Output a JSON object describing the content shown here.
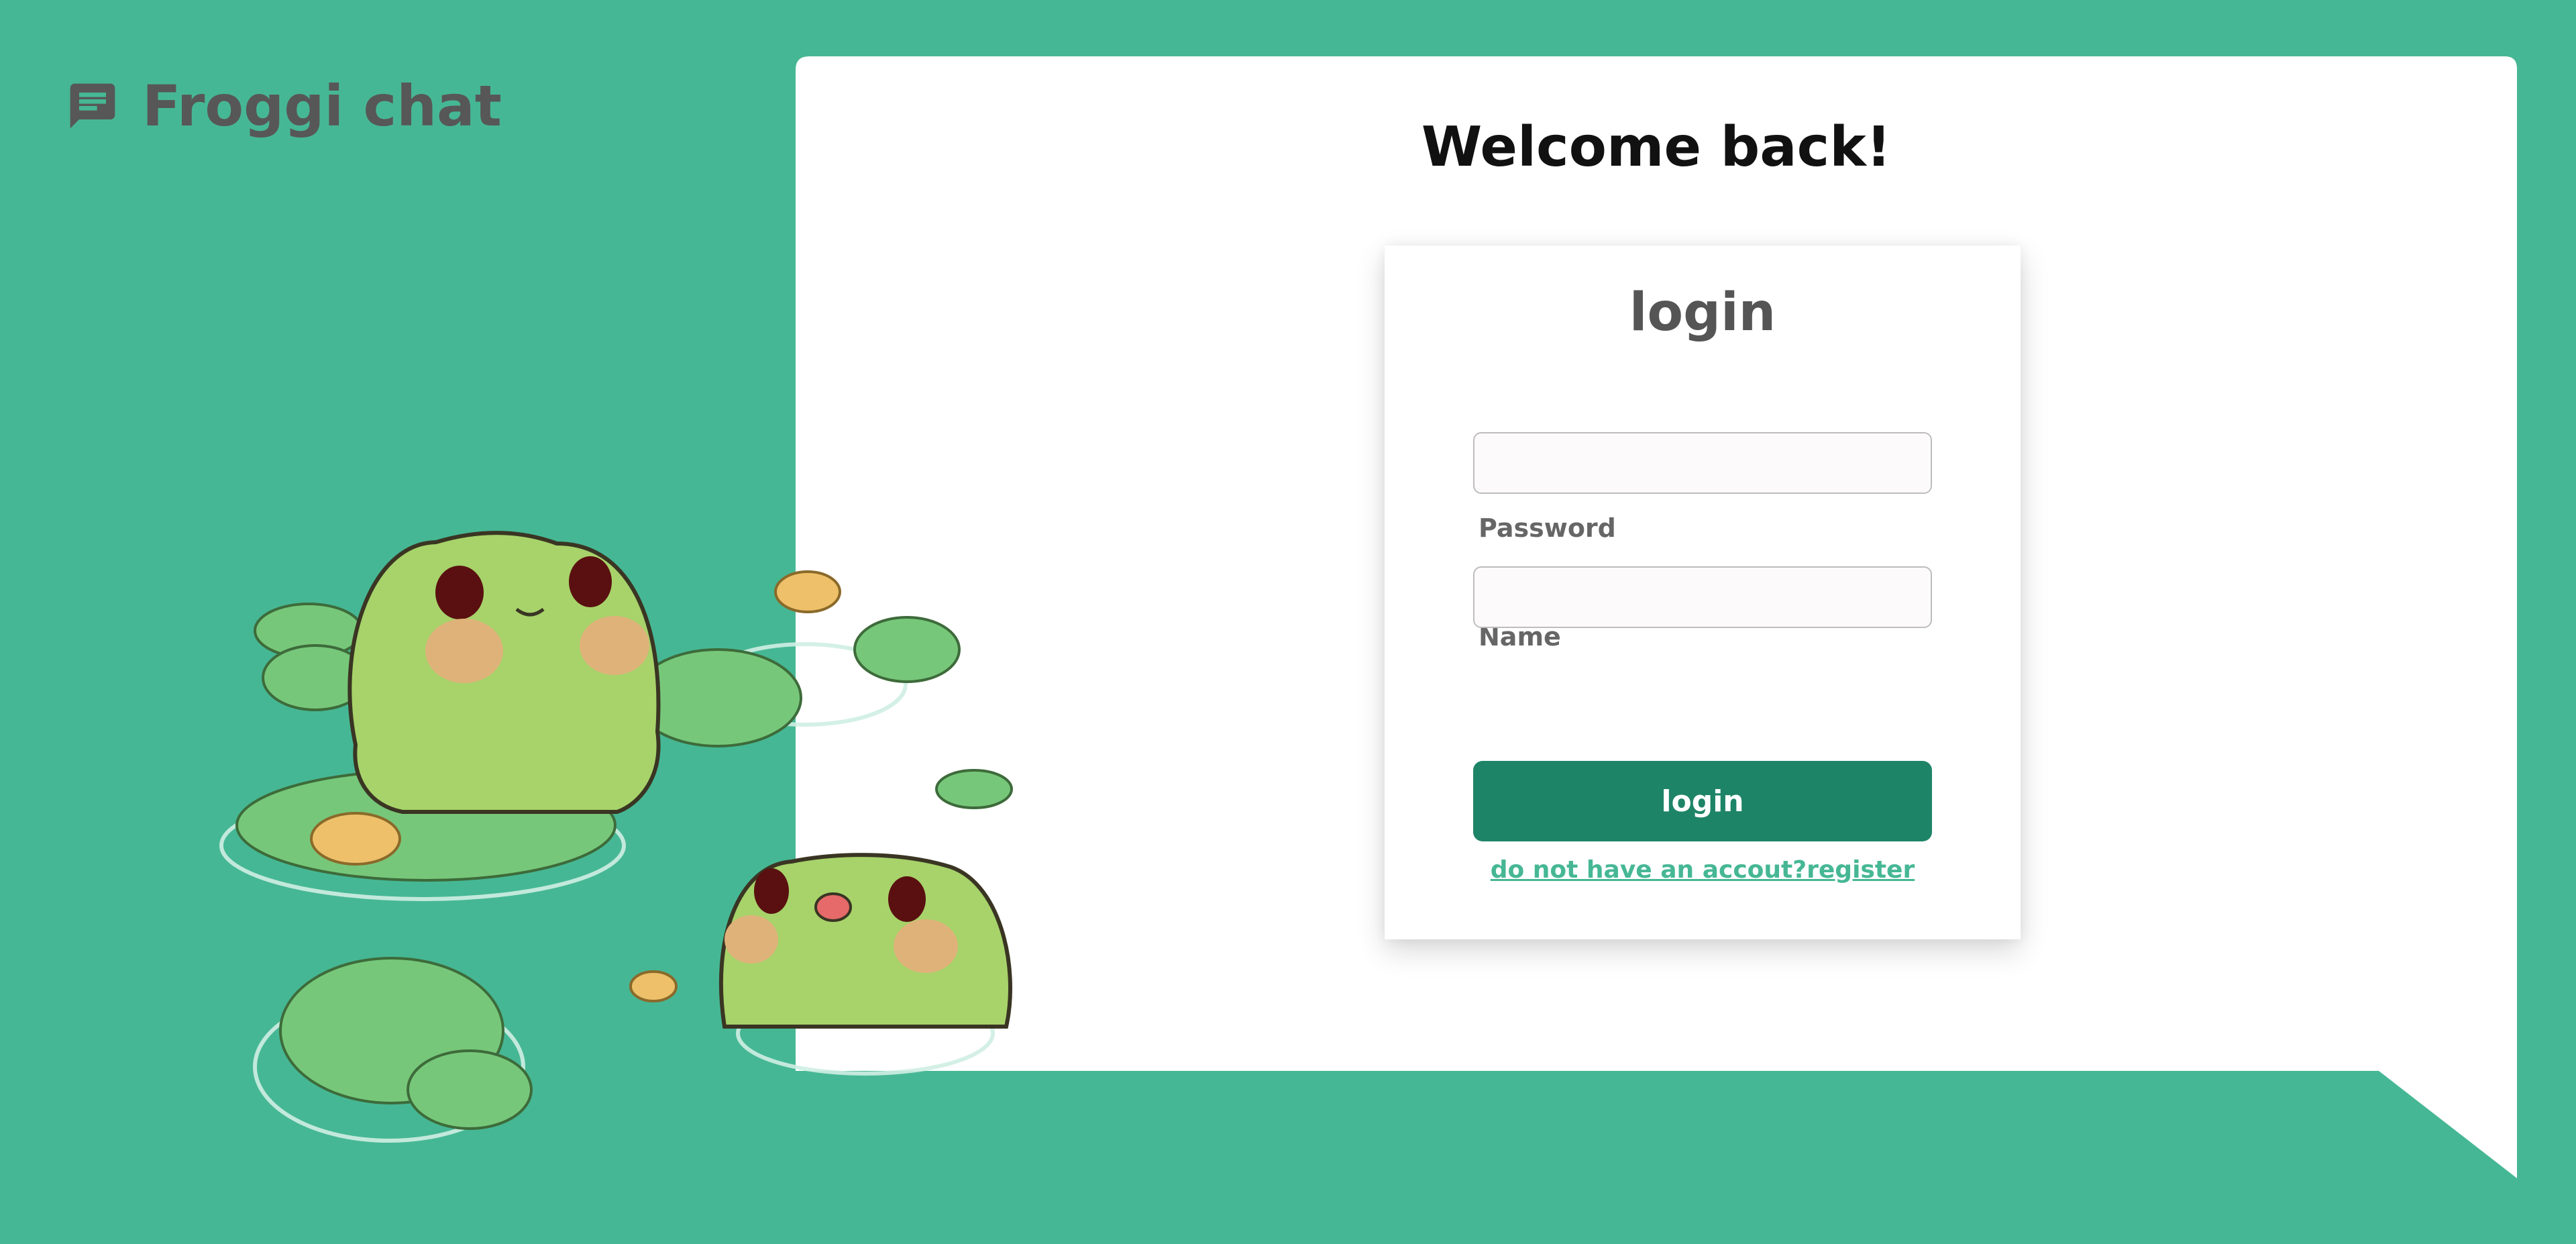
{
  "app": {
    "name": "Froggi chat",
    "brand_icon": "chat-bubble-icon"
  },
  "colors": {
    "background": "#46b794",
    "panel": "#ffffff",
    "primary_button": "#1e8467",
    "link": "#46b794",
    "text_dark": "#111111",
    "text_muted": "#575757"
  },
  "page": {
    "heading": "Welcome back!"
  },
  "login_form": {
    "title": "login",
    "name_label": "Name",
    "name_value": "",
    "password_label": "Password",
    "password_value": "",
    "submit_label": "login",
    "register_link": "do not have an accout?register"
  },
  "illustration": {
    "subject": "frogs-on-lily-pads-illustration"
  }
}
